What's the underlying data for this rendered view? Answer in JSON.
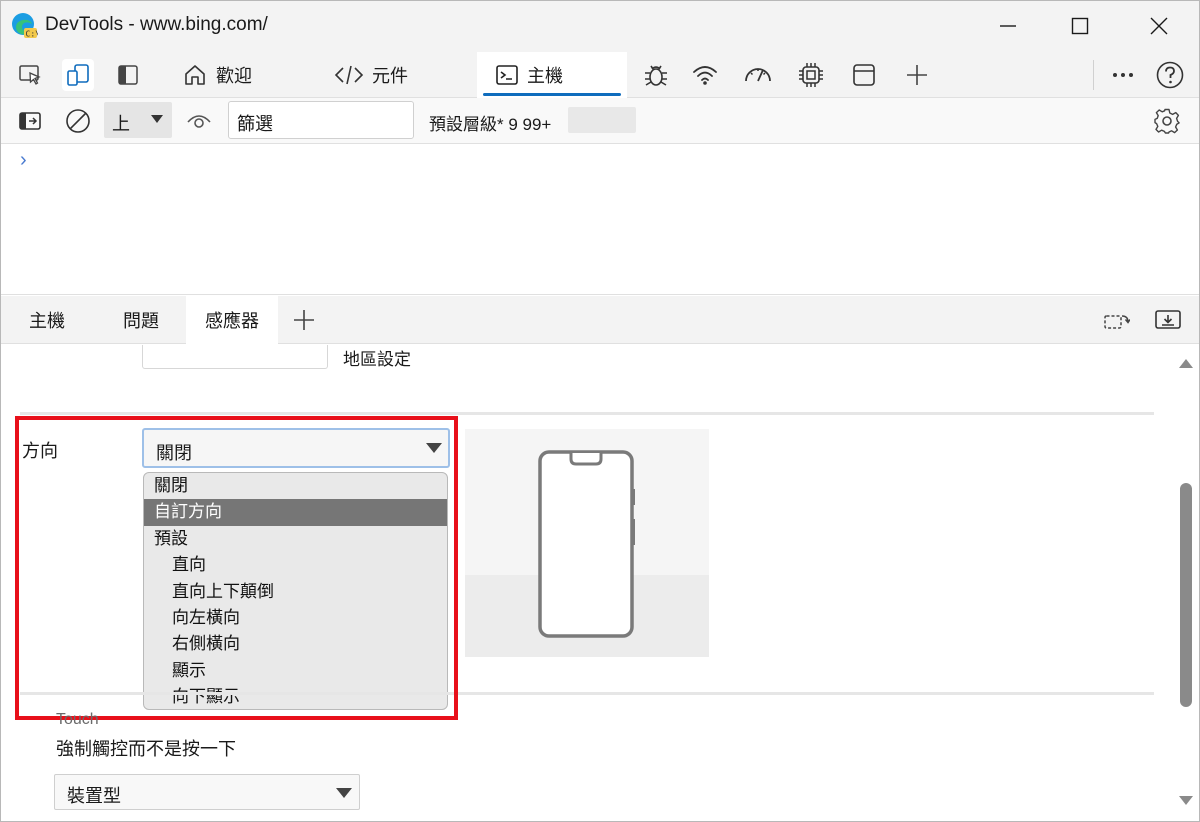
{
  "window": {
    "title": "DevTools - www.bing.com/"
  },
  "toolbar": {
    "tabs": [
      {
        "label": "歡迎",
        "icon": "home-icon"
      },
      {
        "label": "元件",
        "icon": "code-icon"
      },
      {
        "label": "主機",
        "icon": "console-icon",
        "selected": true
      }
    ],
    "tools": [
      "bug-icon",
      "wifi-icon",
      "performance-icon",
      "memory-chip-icon",
      "application-icon",
      "add-icon"
    ]
  },
  "console_toolbar": {
    "context": "上",
    "filter_value": "篩選",
    "levels": "預設層級* 9 99+"
  },
  "console": {
    "prompt": "›"
  },
  "drawer": {
    "tabs": [
      {
        "label": "主機"
      },
      {
        "label": "問題"
      },
      {
        "label": "感應器",
        "selected": true
      }
    ]
  },
  "sensors": {
    "locale_label": "地區設定",
    "orientation_label": "方向",
    "orientation_value": "關閉",
    "orientation_options": [
      {
        "label": "關閉",
        "indent": false
      },
      {
        "label": "自訂方向",
        "indent": false,
        "highlighted": true
      },
      {
        "label": "預設",
        "indent": false
      },
      {
        "label": "直向",
        "indent": true
      },
      {
        "label": "直向上下顛倒",
        "indent": true
      },
      {
        "label": "向左橫向",
        "indent": true
      },
      {
        "label": "右側橫向",
        "indent": true
      },
      {
        "label": "顯示",
        "indent": true
      },
      {
        "label": "向下顯示",
        "indent": true
      }
    ],
    "touch_title": "Touch",
    "touch_description": "強制觸控而不是按一下",
    "touch_value": "裝置型"
  },
  "colors": {
    "accent": "#0f6cbd",
    "highlight_box": "#e8101a",
    "dropdown_highlight": "#767676"
  }
}
